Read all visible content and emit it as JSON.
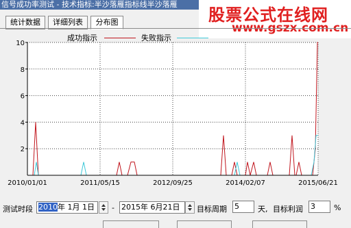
{
  "window": {
    "title": "信号成功率测试 - 技术指标:半沙落雁指标线半沙落雁"
  },
  "watermark": {
    "line1": "股票公式在线网",
    "line2": "www.gszx.com.cn"
  },
  "tabs": [
    {
      "label": "统计数据"
    },
    {
      "label": "详细列表"
    },
    {
      "label": "分布图"
    }
  ],
  "legend": {
    "success": "成功指示",
    "fail": "失败指示"
  },
  "colors": {
    "success": "#c0141c",
    "fail": "#3cc8d8",
    "grid": "#404040"
  },
  "chart_data": {
    "type": "line",
    "ylim": [
      0,
      10
    ],
    "y_ticks": [
      "10",
      "8",
      "6",
      "4",
      "2"
    ],
    "x_tick_labels": [
      "2010/01/01",
      "2011/05/15",
      "2012/09/25",
      "2014/02/07",
      "2015/06/21"
    ],
    "series": [
      {
        "name": "成功指示",
        "color": "#c0141c",
        "points": [
          [
            0,
            0
          ],
          [
            8,
            0
          ],
          [
            12,
            4
          ],
          [
            16,
            0
          ],
          [
            130,
            0
          ],
          [
            134,
            1
          ],
          [
            138,
            0
          ],
          [
            146,
            0
          ],
          [
            151,
            1
          ],
          [
            156,
            1
          ],
          [
            160,
            0
          ],
          [
            282,
            0
          ],
          [
            286,
            3
          ],
          [
            290,
            0
          ],
          [
            298,
            0
          ],
          [
            302,
            1
          ],
          [
            306,
            0
          ],
          [
            318,
            0
          ],
          [
            321,
            1
          ],
          [
            325,
            0
          ],
          [
            330,
            1
          ],
          [
            334,
            0
          ],
          [
            350,
            0
          ],
          [
            354,
            1
          ],
          [
            358,
            0
          ],
          [
            382,
            0
          ],
          [
            386,
            3
          ],
          [
            390,
            0
          ],
          [
            392,
            0
          ],
          [
            396,
            1
          ],
          [
            400,
            0
          ],
          [
            416,
            0
          ],
          [
            420,
            2
          ],
          [
            423,
            10
          ],
          [
            424,
            10
          ]
        ]
      },
      {
        "name": "失败指示",
        "color": "#3cc8d8",
        "points": [
          [
            0,
            0
          ],
          [
            10,
            0
          ],
          [
            13,
            1
          ],
          [
            16,
            0
          ],
          [
            78,
            0
          ],
          [
            82,
            1
          ],
          [
            86,
            0
          ],
          [
            302,
            0
          ],
          [
            306,
            1
          ],
          [
            310,
            0
          ],
          [
            414,
            0
          ],
          [
            418,
            1
          ],
          [
            421,
            3
          ],
          [
            424,
            3
          ]
        ]
      }
    ]
  },
  "controls": {
    "test_period_label": "测试时段",
    "start_date": {
      "year": "2010",
      "rest": "年 1月 1日"
    },
    "dash": "-",
    "end_date": "2015年 6月21日",
    "target_period_label": "目标周期",
    "target_period_value": "5",
    "day_unit": "天,",
    "target_profit_label": "目标利润",
    "target_profit_value": "3",
    "percent": "%"
  }
}
